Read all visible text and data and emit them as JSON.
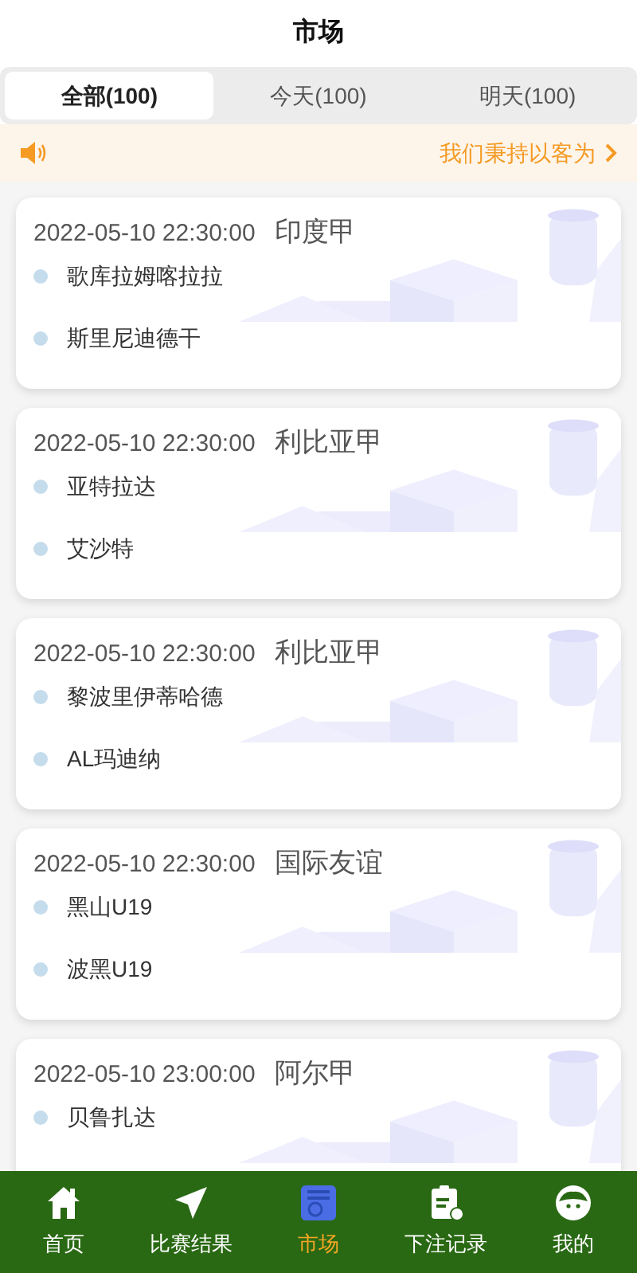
{
  "header": {
    "title": "市场"
  },
  "tabs": [
    {
      "label": "全部(100)",
      "selected": true
    },
    {
      "label": "今天(100)",
      "selected": false
    },
    {
      "label": "明天(100)",
      "selected": false
    }
  ],
  "notice": {
    "text": "我们秉持以客为"
  },
  "matches": [
    {
      "time": "2022-05-10 22:30:00",
      "league": "印度甲",
      "teams": [
        "歌库拉姆喀拉拉",
        "斯里尼迪德干"
      ]
    },
    {
      "time": "2022-05-10 22:30:00",
      "league": "利比亚甲",
      "teams": [
        "亚特拉达",
        "艾沙特"
      ]
    },
    {
      "time": "2022-05-10 22:30:00",
      "league": "利比亚甲",
      "teams": [
        "黎波里伊蒂哈德",
        "AL玛迪纳"
      ]
    },
    {
      "time": "2022-05-10 22:30:00",
      "league": "国际友谊",
      "teams": [
        "黑山U19",
        "波黑U19"
      ]
    },
    {
      "time": "2022-05-10 23:00:00",
      "league": "阿尔甲",
      "teams": [
        "贝鲁扎达"
      ]
    }
  ],
  "nav": [
    {
      "kind": "home",
      "label": "首页",
      "selected": false
    },
    {
      "kind": "results",
      "label": "比赛结果",
      "selected": false
    },
    {
      "kind": "market",
      "label": "市场",
      "selected": true
    },
    {
      "kind": "records",
      "label": "下注记录",
      "selected": false
    },
    {
      "kind": "me",
      "label": "我的",
      "selected": false
    }
  ]
}
